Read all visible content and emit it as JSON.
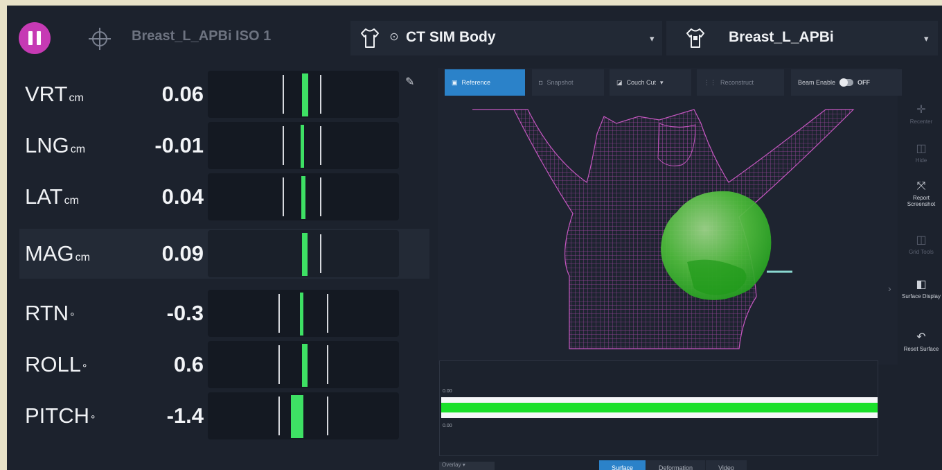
{
  "header": {
    "iso_label": "Breast_L_APBi ISO 1",
    "body_select": "CT SIM Body",
    "roi_select": "Breast_L_APBi"
  },
  "readouts": [
    {
      "axis": "VRT",
      "unit": "cm",
      "value": "0.06",
      "offset": 0.06
    },
    {
      "axis": "LNG",
      "unit": "cm",
      "value": "-0.01",
      "offset": -0.01
    },
    {
      "axis": "LAT",
      "unit": "cm",
      "value": "0.04",
      "offset": 0.04
    },
    {
      "axis": "MAG",
      "unit": "cm",
      "value": "0.09",
      "offset": 0.09
    },
    {
      "axis": "RTN",
      "unit": "°",
      "value": "-0.3",
      "offset": -0.3
    },
    {
      "axis": "ROLL",
      "unit": "°",
      "value": "0.6",
      "offset": 0.6
    },
    {
      "axis": "PITCH",
      "unit": "°",
      "value": "-1.4",
      "offset": -1.4
    }
  ],
  "viewer": {
    "toolbar": [
      "Reference",
      "Snapshot",
      "Couch Cut",
      "Reconstruct",
      "Beam Enable"
    ],
    "beam_toggle": "OFF",
    "tools": [
      "Recenter",
      "Hide",
      "Report Screenshot",
      "Grid Tools",
      "Surface Display",
      "Reset Surface"
    ]
  },
  "timeline": {
    "upper_label": "0.00",
    "lower_label": "0.00"
  },
  "bottom": {
    "select": "Overlay",
    "tabs": [
      "Surface",
      "Deformation",
      "Video"
    ],
    "active_tab": "Surface"
  },
  "colors": {
    "accent": "#c63ab4",
    "bar": "#3ee064",
    "active": "#2b82c9",
    "mesh": "#b14bb0",
    "roi": "#45c236"
  }
}
